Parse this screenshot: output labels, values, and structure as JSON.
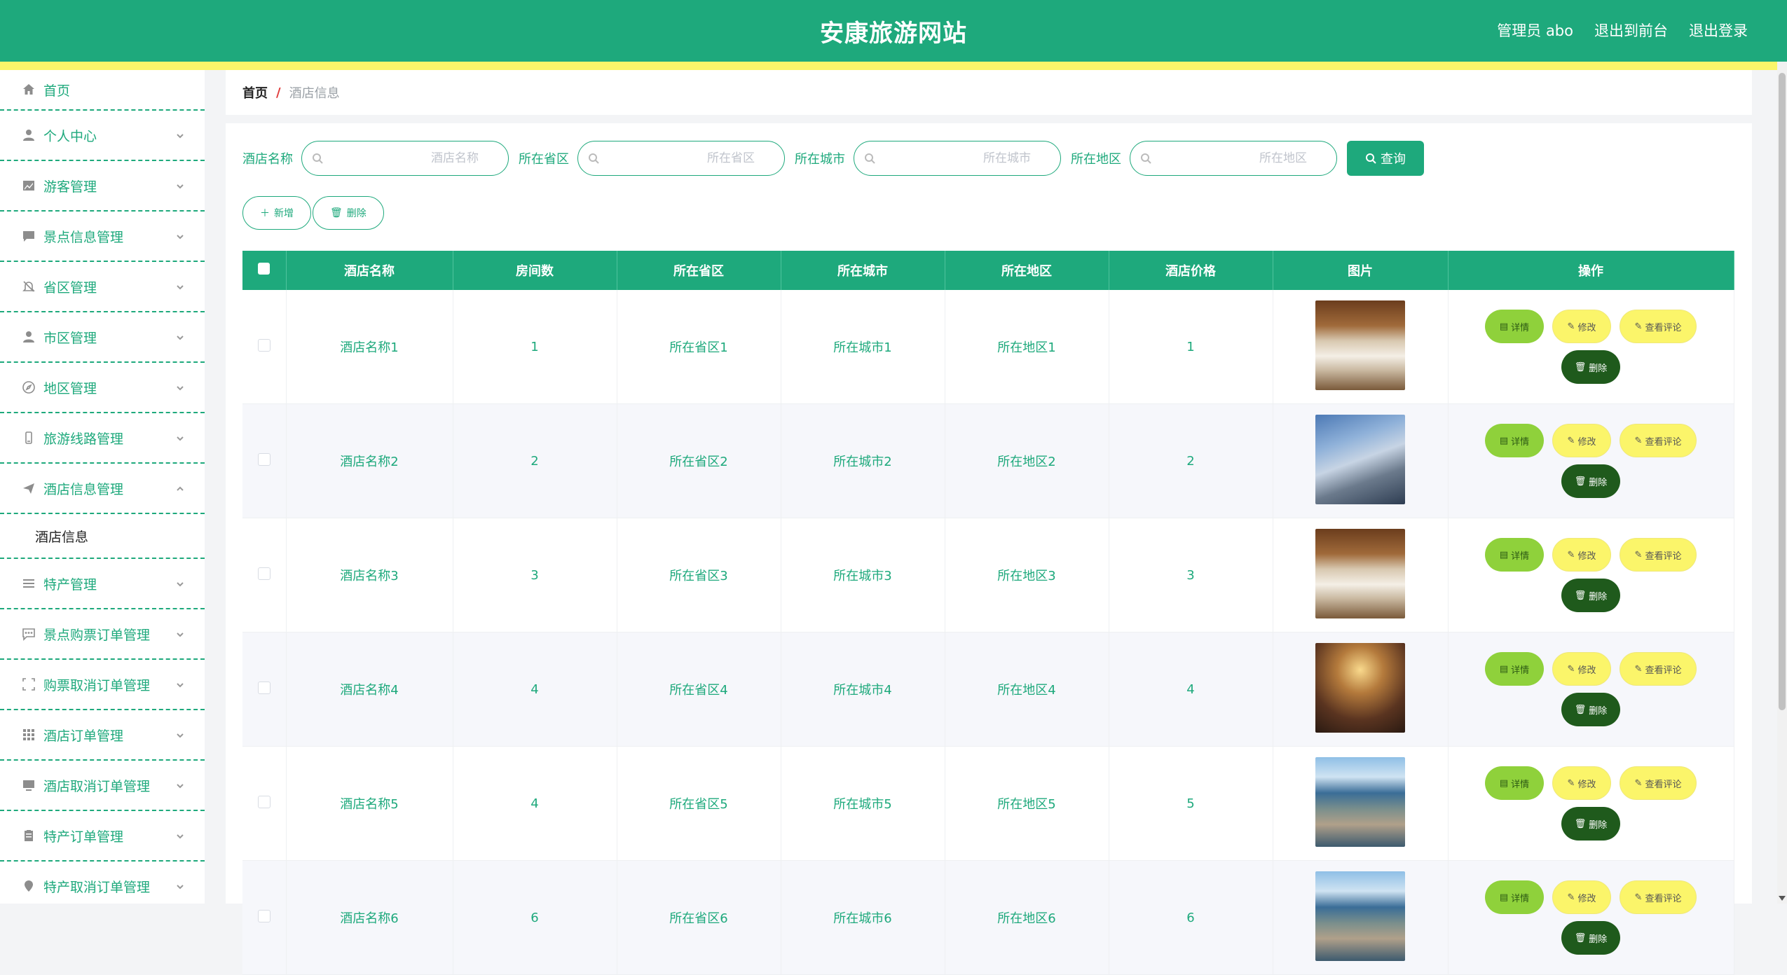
{
  "header": {
    "title": "安康旅游网站",
    "admin": "管理员 abo",
    "front": "退出到前台",
    "logout": "退出登录",
    "colors": {
      "primary": "#1ea97c",
      "accent": "#fbf56a"
    }
  },
  "sidebar": {
    "home": "首页",
    "items": [
      {
        "label": "个人中心",
        "icon": "user-icon"
      },
      {
        "label": "游客管理",
        "icon": "chart-icon"
      },
      {
        "label": "景点信息管理",
        "icon": "chat-icon"
      },
      {
        "label": "省区管理",
        "icon": "bell-off-icon"
      },
      {
        "label": "市区管理",
        "icon": "user-icon"
      },
      {
        "label": "地区管理",
        "icon": "compass-icon"
      },
      {
        "label": "旅游线路管理",
        "icon": "phone-icon"
      },
      {
        "label": "酒店信息管理",
        "icon": "send-icon",
        "expanded": true,
        "sub": "酒店信息"
      },
      {
        "label": "特产管理",
        "icon": "list-icon"
      },
      {
        "label": "景点购票订单管理",
        "icon": "message-icon"
      },
      {
        "label": "购票取消订单管理",
        "icon": "scan-icon"
      },
      {
        "label": "酒店订单管理",
        "icon": "grid-icon"
      },
      {
        "label": "酒店取消订单管理",
        "icon": "monitor-icon"
      },
      {
        "label": "特产订单管理",
        "icon": "clipboard-icon"
      },
      {
        "label": "特产取消订单管理",
        "icon": "pin-icon"
      }
    ]
  },
  "breadcrumb": {
    "home": "首页",
    "sep": "/",
    "current": "酒店信息"
  },
  "search": {
    "fields": [
      {
        "label": "酒店名称",
        "placeholder": "酒店名称"
      },
      {
        "label": "所在省区",
        "placeholder": "所在省区"
      },
      {
        "label": "所在城市",
        "placeholder": "所在城市"
      },
      {
        "label": "所在地区",
        "placeholder": "所在地区"
      }
    ],
    "query": "查询"
  },
  "actions": {
    "add": "新增",
    "delete": "删除"
  },
  "table": {
    "headers": [
      "酒店名称",
      "房间数",
      "所在省区",
      "所在城市",
      "所在地区",
      "酒店价格",
      "图片",
      "操作"
    ],
    "ops": {
      "detail": "详情",
      "edit": "修改",
      "review": "查看评论",
      "delete": "删除"
    },
    "rows": [
      {
        "name": "酒店名称1",
        "rooms": "1",
        "province": "所在省区1",
        "city": "所在城市1",
        "district": "所在地区1",
        "price": "1",
        "image": "hotel-room-photo"
      },
      {
        "name": "酒店名称2",
        "rooms": "2",
        "province": "所在省区2",
        "city": "所在城市2",
        "district": "所在地区2",
        "price": "2",
        "image": "hotel-building-photo"
      },
      {
        "name": "酒店名称3",
        "rooms": "3",
        "province": "所在省区3",
        "city": "所在城市3",
        "district": "所在地区3",
        "price": "3",
        "image": "hotel-room-photo"
      },
      {
        "name": "酒店名称4",
        "rooms": "4",
        "province": "所在省区4",
        "city": "所在城市4",
        "district": "所在地区4",
        "price": "4",
        "image": "banquet-hall-photo"
      },
      {
        "name": "酒店名称5",
        "rooms": "4",
        "province": "所在省区5",
        "city": "所在城市5",
        "district": "所在地区5",
        "price": "5",
        "image": "coastal-resort-photo"
      },
      {
        "name": "酒店名称6",
        "rooms": "6",
        "province": "所在省区6",
        "city": "所在城市6",
        "district": "所在地区6",
        "price": "6",
        "image": "coastal-resort-photo"
      }
    ]
  }
}
